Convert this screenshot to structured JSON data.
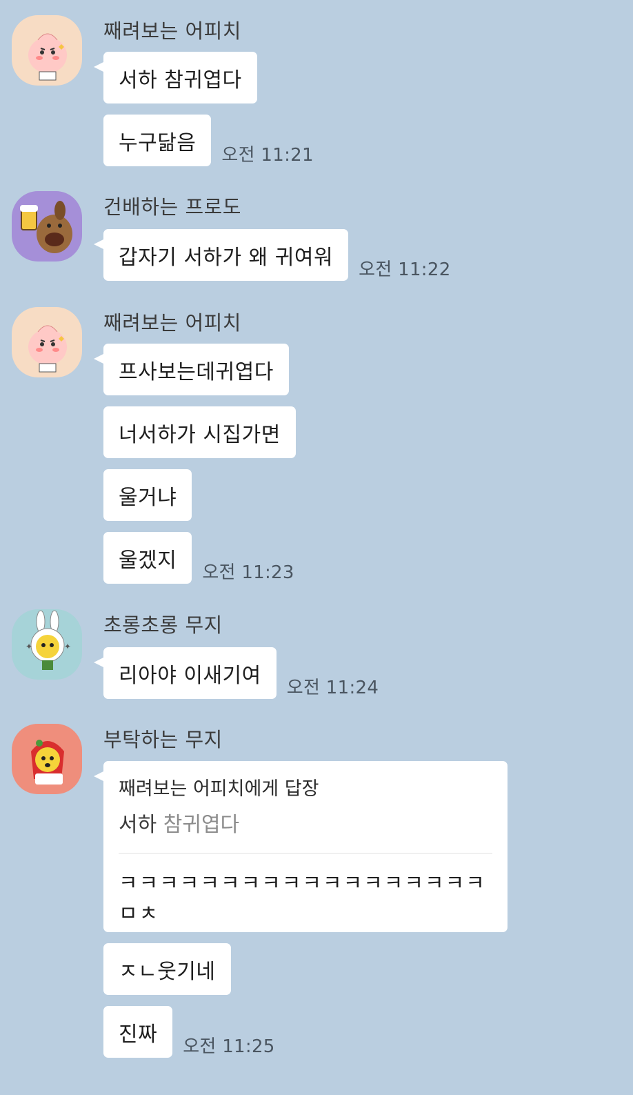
{
  "groups": [
    {
      "sender": "째려보는 어피치",
      "avatar": "apeach-glare-avatar",
      "messages": [
        "서하 참귀엽다",
        "누구닮음"
      ],
      "time": "오전 11:21"
    },
    {
      "sender": "건배하는 프로도",
      "avatar": "frodo-cheers-avatar",
      "messages": [
        "갑자기 서하가 왜 귀여워"
      ],
      "time": "오전 11:22"
    },
    {
      "sender": "째려보는 어피치",
      "avatar": "apeach-glare-avatar",
      "messages": [
        "프사보는데귀엽다",
        "너서하가 시집가면",
        "울거냐",
        "울겠지"
      ],
      "time": "오전 11:23"
    },
    {
      "sender": "초롱초롱 무지",
      "avatar": "muzi-sparkle-avatar",
      "messages": [
        "리아야 이새기여"
      ],
      "time": "오전 11:24"
    },
    {
      "sender": "부탁하는 무지",
      "avatar": "muzi-please-avatar",
      "reply": {
        "to": "째려보는 어피치에게 답장",
        "quoted_highlight": "서하",
        "quoted_rest": " 참귀엽다",
        "text": "ㅋㅋㅋㅋㅋㅋㅋㅋㅋㅋㅋㅋㅋㅋㅋㅋㅋㅋ ㅁㅊ"
      },
      "messages": [
        "ㅈㄴ웃기네",
        "진짜"
      ],
      "time": "오전 11:25"
    }
  ],
  "colors": {
    "background": "#bacee0",
    "bubble": "#ffffff",
    "apeach_bg": "#f7dcc4",
    "frodo_bg": "#a58fd8",
    "muzi_sparkle_bg": "#a6d3d8",
    "muzi_please_bg": "#ef8e7c"
  }
}
